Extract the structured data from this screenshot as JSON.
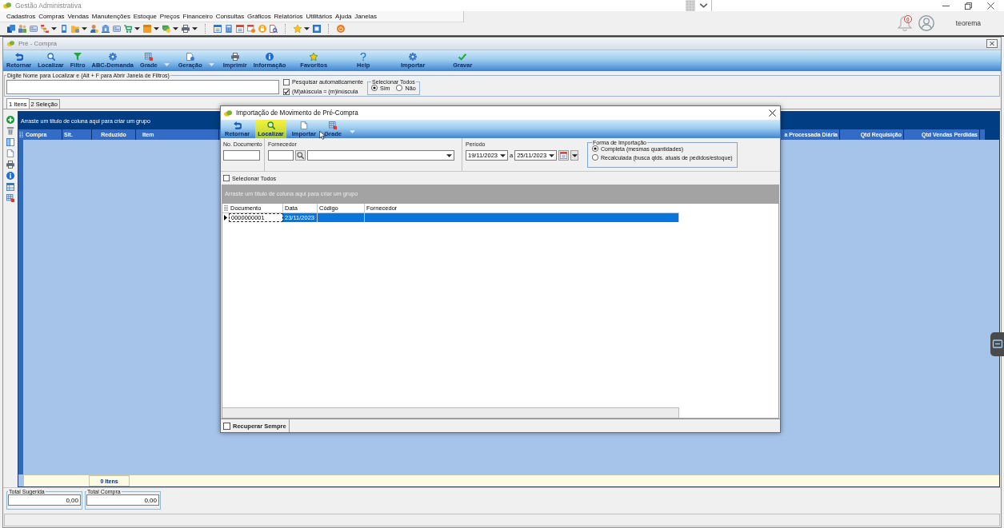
{
  "app": {
    "title": "Gestão Administrativa",
    "menu": [
      "Cadastros",
      "Compras",
      "Vendas",
      "Manutenções",
      "Estoque",
      "Preços",
      "Financeiro",
      "Consultas",
      "Gráficos",
      "Relatórios",
      "Utilitários",
      "Ajuda",
      "Janelas"
    ],
    "notifications": "0",
    "user": "teorema"
  },
  "child_window": {
    "title": "Pré - Compra",
    "toolbar": [
      {
        "label": "Retornar",
        "kind": "button"
      },
      {
        "label": "Localizar",
        "kind": "button"
      },
      {
        "label": "Filtro",
        "kind": "button"
      },
      {
        "label": "ABC-Demanda",
        "kind": "button"
      },
      {
        "label": "Grade",
        "kind": "dropdown"
      },
      {
        "label": "Geração",
        "kind": "dropdown"
      },
      {
        "label": "Imprimir",
        "kind": "button"
      },
      {
        "label": "Informação",
        "kind": "button"
      },
      {
        "label": "Favoritos",
        "kind": "button"
      },
      {
        "label": "Help",
        "kind": "button"
      },
      {
        "label": "Importar",
        "kind": "button"
      },
      {
        "label": "Gravar",
        "kind": "button"
      }
    ],
    "search": {
      "label": "Digite Nome para Localizar e (Alt + F para Abrir Janela de Filtros)"
    },
    "options": [
      {
        "label": "Pesquisar automaticamente",
        "checked": false
      },
      {
        "label": "(M)aiúscula = (m)inúscula",
        "checked": true
      }
    ],
    "select_all": {
      "label": "Selecionar Todos",
      "options": [
        {
          "label": "Sim",
          "selected": true
        },
        {
          "label": "Não",
          "selected": false
        }
      ]
    },
    "tabs": [
      {
        "label": "1 Itens",
        "selected": true
      },
      {
        "label": "2 Seleção",
        "selected": false
      }
    ],
    "grid": {
      "group_hint": "Arraste um título de coluna aqui para criar um grupo",
      "columns": [
        "Compra",
        "Sit.",
        "Reduzido",
        "Item"
      ],
      "columns_right": [
        "a Processada Diária",
        "Qtd Requisição",
        "Qtd Vendas Perdidas"
      ],
      "footer": "0 Itens"
    },
    "totals": [
      {
        "label": "Total Sugerida",
        "value": "0,00"
      },
      {
        "label": "Total Compra",
        "value": "0,00"
      }
    ]
  },
  "dialog": {
    "title": "Importação de Movimento de Pré-Compra",
    "toolbar": [
      {
        "label": "Retornar",
        "kind": "button",
        "highlighted": false
      },
      {
        "label": "Localizar",
        "kind": "button",
        "highlighted": true
      },
      {
        "label": "Importar",
        "kind": "button",
        "highlighted": false
      },
      {
        "label": "Grade",
        "kind": "dropdown",
        "highlighted": false
      }
    ],
    "document_label": "No. Documento",
    "supplier_label": "Fornecedor",
    "period": {
      "label": "Período",
      "from": "19/11/2023",
      "separator": "a",
      "to": "25/11/2023"
    },
    "import_mode": {
      "legend": "Forma de Importação",
      "options": [
        {
          "label": "Completa (mesmas quantidades)",
          "selected": true
        },
        {
          "label": "Recalculada (busca qtds. atuais de pedidos/estoque)",
          "selected": false
        }
      ]
    },
    "select_all": {
      "label": "Selecionar Todos",
      "checked": false
    },
    "grid": {
      "group_hint": "Arraste um título de coluna aqui para criar um grupo",
      "columns": [
        "Documento",
        "Data",
        "Código",
        "Fornecedor"
      ],
      "rows": [
        {
          "selected": true,
          "cells": [
            {
              "text": "0000000001",
              "focused": true
            },
            {
              "text": "23/11/2023",
              "focused": false
            }
          ]
        }
      ]
    },
    "recover": {
      "label": "Recuperar Sempre",
      "checked": false
    }
  }
}
